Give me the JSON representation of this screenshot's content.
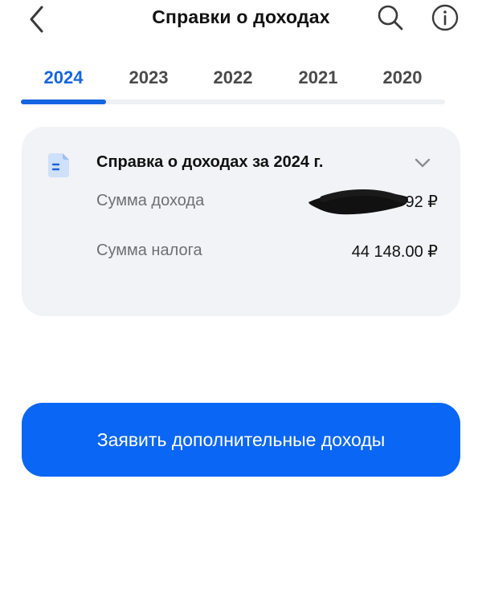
{
  "header": {
    "title": "Справки о доходах",
    "back_icon": "chevron-left-icon",
    "search_icon": "search-icon",
    "info_icon": "info-icon"
  },
  "tabs": [
    {
      "label": "2024",
      "active": true
    },
    {
      "label": "2023",
      "active": false
    },
    {
      "label": "2022",
      "active": false
    },
    {
      "label": "2021",
      "active": false
    },
    {
      "label": "2020",
      "active": false
    }
  ],
  "card": {
    "title": "Справка о доходах за 2024 г.",
    "income_label": "Сумма дохода",
    "income_value": "92 ₽",
    "tax_label": "Сумма налога",
    "tax_value": "44 148.00 ₽",
    "doc_icon": "document-icon",
    "expand_icon": "chevron-down-icon"
  },
  "action": {
    "label": "Заявить дополнительные доходы"
  },
  "colors": {
    "accent": "#1565e0",
    "button": "#0a66f5",
    "card_bg": "#f2f3f6",
    "muted_text": "#6d6f75"
  }
}
